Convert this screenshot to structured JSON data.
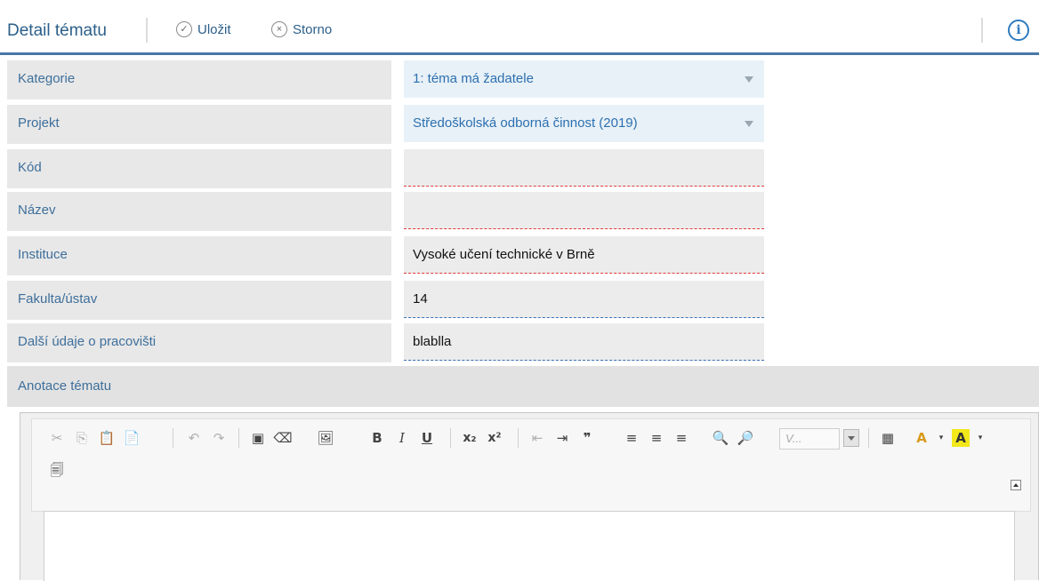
{
  "header": {
    "title": "Detail tématu",
    "save_label": "Uložit",
    "cancel_label": "Storno"
  },
  "form": {
    "rows": [
      {
        "label": "Kategorie",
        "value": "1: téma má žadatele"
      },
      {
        "label": "Projekt",
        "value": "Středoškolská odborná činnost (2019)"
      },
      {
        "label": "Kód",
        "value": ""
      },
      {
        "label": "Název",
        "value": ""
      },
      {
        "label": "Instituce",
        "value": "Vysoké učení technické v Brně"
      },
      {
        "label": "Fakulta/ústav",
        "value": "14"
      },
      {
        "label": "Další údaje o pracovišti",
        "value": "blablla"
      }
    ],
    "annotation_label": "Anotace tématu"
  },
  "editor": {
    "styles_placeholder": "V..."
  },
  "colors": {
    "accent": "#4a77a8",
    "label_text": "#3e6f9b",
    "required_underline": "#e03c3c",
    "filled_underline": "#3a72b8"
  }
}
